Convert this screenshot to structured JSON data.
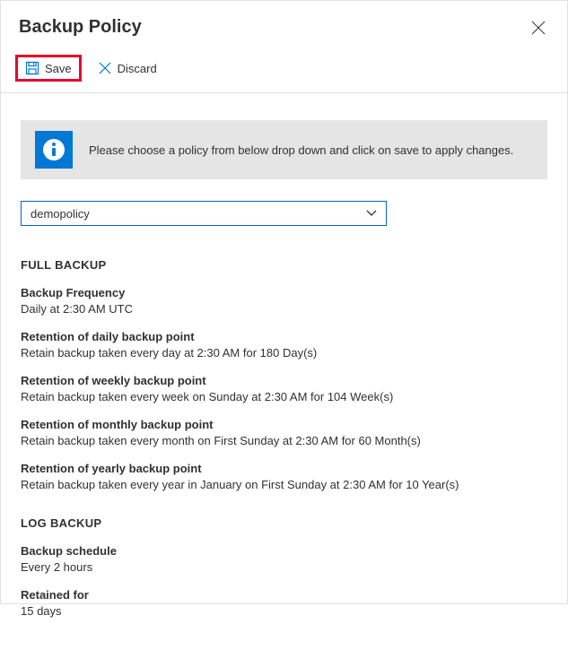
{
  "header": {
    "title": "Backup Policy"
  },
  "toolbar": {
    "save_label": "Save",
    "discard_label": "Discard"
  },
  "info": {
    "message": "Please choose a policy from below drop down and click on save to apply changes."
  },
  "policy_dropdown": {
    "selected": "demopolicy"
  },
  "full_backup": {
    "section_title": "FULL BACKUP",
    "frequency": {
      "label": "Backup Frequency",
      "value": "Daily at 2:30 AM UTC"
    },
    "daily_retention": {
      "label": "Retention of daily backup point",
      "value": "Retain backup taken every day at 2:30 AM for 180 Day(s)"
    },
    "weekly_retention": {
      "label": "Retention of weekly backup point",
      "value": "Retain backup taken every week on Sunday at 2:30 AM for 104 Week(s)"
    },
    "monthly_retention": {
      "label": "Retention of monthly backup point",
      "value": "Retain backup taken every month on First Sunday at 2:30 AM for 60 Month(s)"
    },
    "yearly_retention": {
      "label": "Retention of yearly backup point",
      "value": "Retain backup taken every year in January on First Sunday at 2:30 AM for 10 Year(s)"
    }
  },
  "log_backup": {
    "section_title": "LOG BACKUP",
    "schedule": {
      "label": "Backup schedule",
      "value": "Every 2 hours"
    },
    "retained": {
      "label": "Retained for",
      "value": "15 days"
    }
  }
}
